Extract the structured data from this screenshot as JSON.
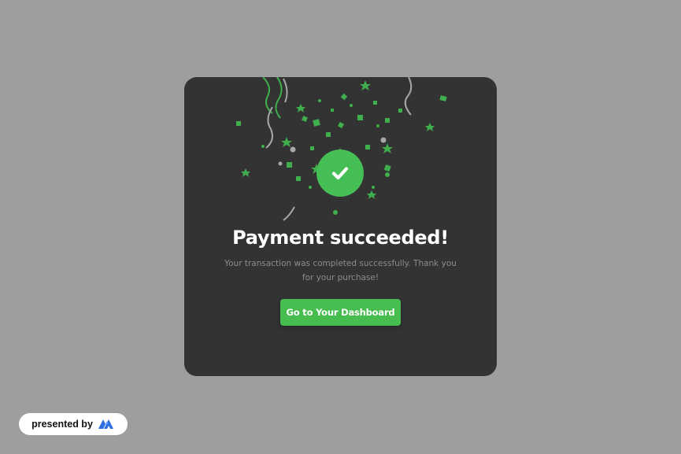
{
  "modal": {
    "title": "Payment succeeded!",
    "message": "Your transaction was completed successfully. Thank you for your purchase!",
    "cta_label": "Go to Your Dashboard",
    "status_icon": "check-icon"
  },
  "badge": {
    "text": "presented by",
    "logo_icon": "brand-logo-icon"
  },
  "colors": {
    "page_background": "#9e9e9e",
    "modal_background": "#333333",
    "accent_green": "#45bf55",
    "confetti_green": "#3fae4c",
    "confetti_gray": "#a8a8a8",
    "message_text": "#8c8c8c",
    "title_text": "#ffffff",
    "brand_blue": "#2b6ee0"
  }
}
